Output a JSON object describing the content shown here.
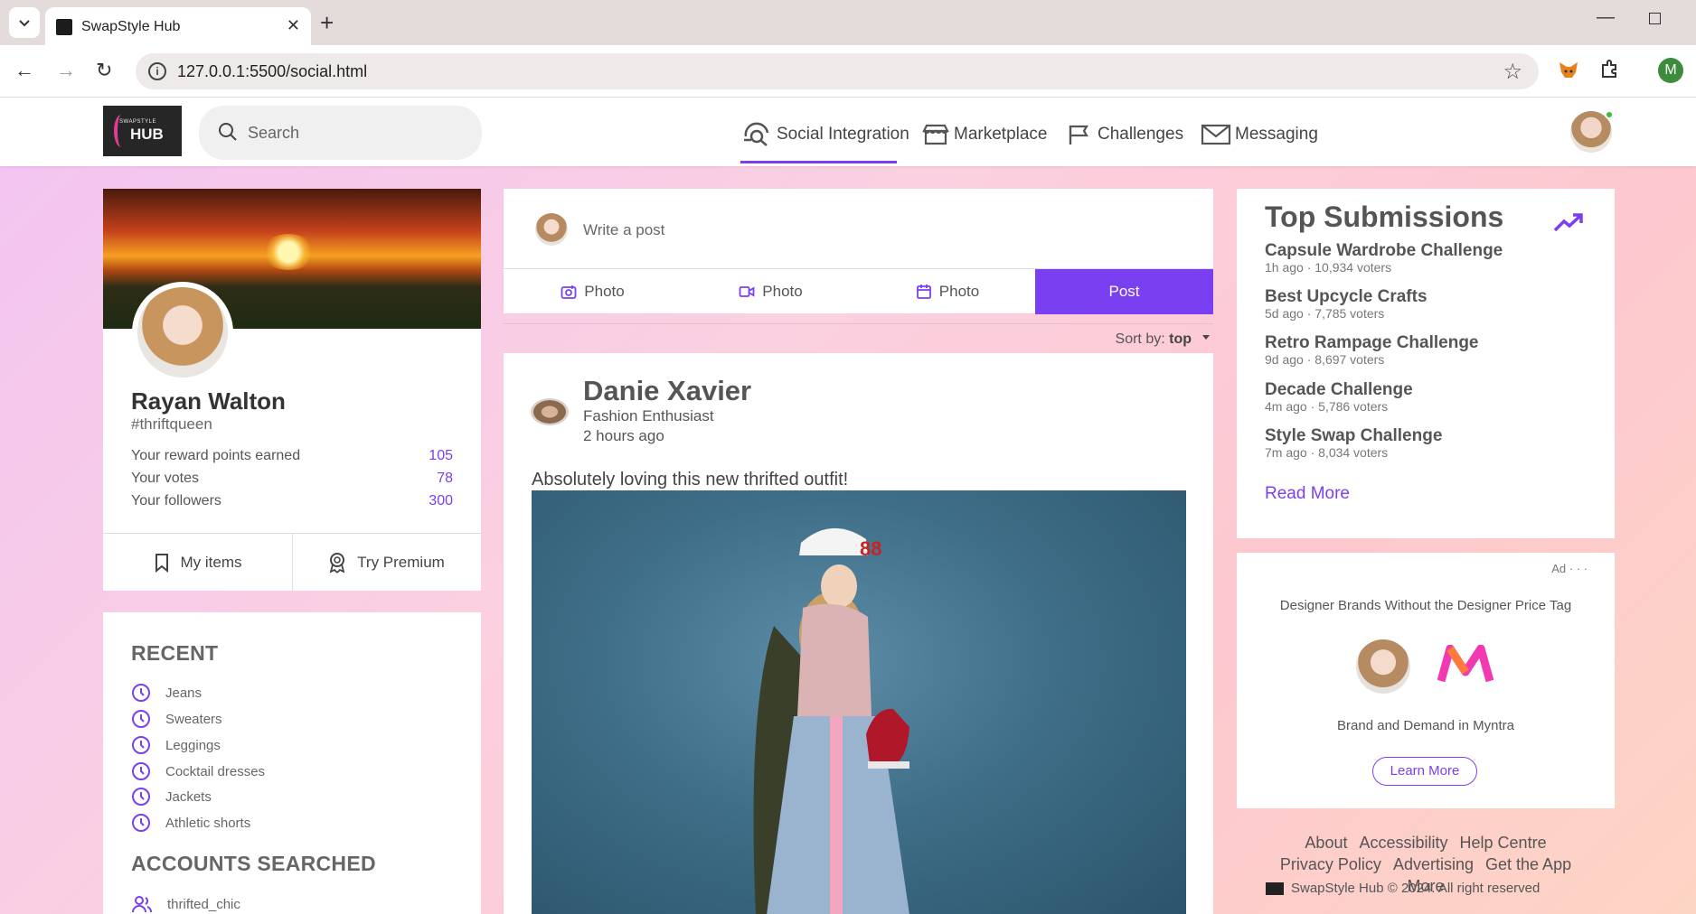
{
  "browser": {
    "tab_title": "SwapStyle Hub",
    "url": "127.0.0.1:5500/social.html",
    "profile_initial": "M"
  },
  "header": {
    "search_placeholder": "Search",
    "nav": [
      {
        "label": "Social Integration",
        "icon": "social-icon",
        "active": true
      },
      {
        "label": "Marketplace",
        "icon": "store-icon"
      },
      {
        "label": "Challenges",
        "icon": "flag-icon"
      },
      {
        "label": "Messaging",
        "icon": "mail-icon"
      }
    ]
  },
  "profile": {
    "name": "Rayan Walton",
    "handle": "#thriftqueen",
    "stats": [
      {
        "label": "Your reward points earned",
        "value": "105"
      },
      {
        "label": "Your votes",
        "value": "78"
      },
      {
        "label": "Your followers",
        "value": "300"
      }
    ],
    "actions": [
      {
        "label": "My items",
        "icon": "bookmark-icon"
      },
      {
        "label": "Try Premium",
        "icon": "award-icon"
      }
    ]
  },
  "recent": {
    "title": "RECENT",
    "items": [
      "Jeans",
      "Sweaters",
      "Leggings",
      "Cocktail dresses",
      "Jackets",
      "Athletic shorts"
    ],
    "accounts_title": "ACCOUNTS SEARCHED",
    "accounts": [
      "thrifted_chic"
    ]
  },
  "composer": {
    "placeholder": "Write a post",
    "actions": [
      "Photo",
      "Photo",
      "Photo"
    ],
    "post_label": "Post",
    "sort_label": "Sort by:",
    "sort_value": "top"
  },
  "post": {
    "author": "Danie Xavier",
    "role": "Fashion Enthusiast",
    "time": "2 hours ago",
    "text": "Absolutely loving this new thrifted outfit!"
  },
  "top_submissions": {
    "title": "Top Submissions",
    "items": [
      {
        "title": "Capsule Wardrobe Challenge",
        "meta": "1h ago · 10,934 voters"
      },
      {
        "title": "Best Upcycle Crafts",
        "meta": "5d ago · 7,785 voters"
      },
      {
        "title": "Retro Rampage Challenge",
        "meta": "9d ago · 8,697 voters"
      },
      {
        "title": "Decade Challenge",
        "meta": "4m ago · 5,786 voters"
      },
      {
        "title": "Style Swap Challenge",
        "meta": "7m ago · 8,034 voters"
      }
    ],
    "read_more": "Read More"
  },
  "ad": {
    "label": "Ad · · ·",
    "headline": "Designer Brands Without the Designer Price Tag",
    "sub": "Brand and Demand in Myntra",
    "cta": "Learn More"
  },
  "footer": {
    "links": [
      "About",
      "Accessibility",
      "Help Centre",
      "Privacy Policy",
      "Advertising",
      "Get the App",
      "More"
    ],
    "copyright": "SwapStyle Hub © 2024. All right reserved"
  },
  "colors": {
    "accent": "#7b3ff2"
  }
}
